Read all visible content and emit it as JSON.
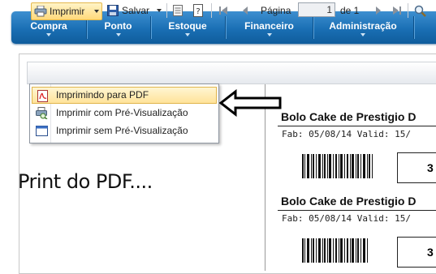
{
  "nav": {
    "items": [
      {
        "label": "Compra"
      },
      {
        "label": "Ponto"
      },
      {
        "label": "Estoque"
      },
      {
        "label": "Financeiro"
      },
      {
        "label": "Administração"
      }
    ]
  },
  "toolbar": {
    "print_label": "Imprimir",
    "save_label": "Salvar",
    "page_label": "Página",
    "page_value": "1",
    "of_label": "de 1"
  },
  "print_menu": {
    "items": [
      {
        "label": "Imprimindo para PDF",
        "icon": "pdf-icon",
        "selected": true
      },
      {
        "label": "Imprimir com Pré-Visualização",
        "icon": "print-preview-icon",
        "selected": false
      },
      {
        "label": "Imprimir sem Pré-Visualização",
        "icon": "window-icon",
        "selected": false
      }
    ]
  },
  "caption": "Print do PDF....",
  "labels": [
    {
      "title": "Bolo Cake de Prestigio D",
      "info": "Fab: 05/08/14 Valid: 15/",
      "qty": "3"
    },
    {
      "title": "Bolo Cake de Prestigio D",
      "info": "Fab: 05/08/14 Valid: 15/",
      "qty": "3"
    }
  ],
  "colors": {
    "nav_blue": "#1a6fb4",
    "menu_highlight": "#ffe39a"
  }
}
